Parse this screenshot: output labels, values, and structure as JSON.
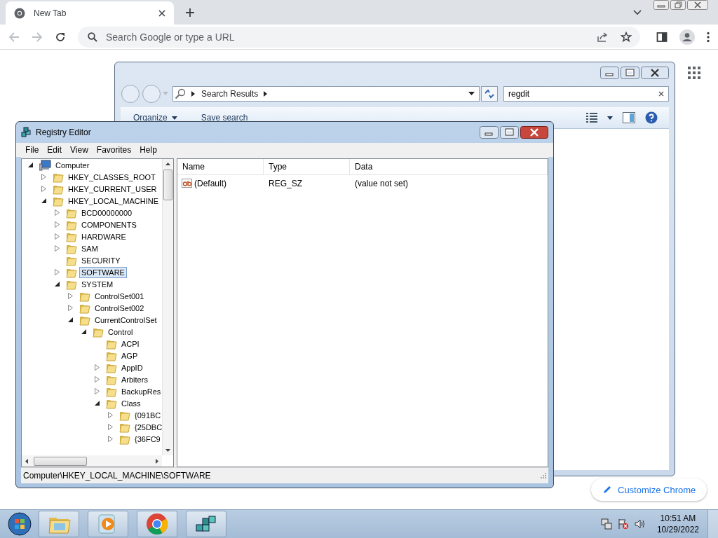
{
  "browser": {
    "tab": {
      "title": "New Tab"
    },
    "omnibox": {
      "placeholder": "Search Google or type a URL"
    },
    "customize_button": "Customize Chrome"
  },
  "explorer": {
    "address": {
      "crumb": "Search Results"
    },
    "search": {
      "value": "regdit"
    },
    "toolbar": [
      {
        "label": "Organize",
        "dropdown": true
      },
      {
        "label": "Save search",
        "dropdown": false
      }
    ]
  },
  "regedit": {
    "title": "Registry Editor",
    "menu": [
      "File",
      "Edit",
      "View",
      "Favorites",
      "Help"
    ],
    "tree": [
      {
        "label": "Computer",
        "kind": "computer",
        "expandable": true,
        "expanded": true,
        "selected": false,
        "children": [
          {
            "label": "HKEY_CLASSES_ROOT",
            "kind": "folder",
            "expandable": true,
            "expanded": false,
            "selected": false
          },
          {
            "label": "HKEY_CURRENT_USER",
            "kind": "folder",
            "expandable": true,
            "expanded": false,
            "selected": false
          },
          {
            "label": "HKEY_LOCAL_MACHINE",
            "kind": "folder",
            "expandable": true,
            "expanded": true,
            "selected": false,
            "children": [
              {
                "label": "BCD00000000",
                "kind": "folder",
                "expandable": true,
                "expanded": false,
                "selected": false
              },
              {
                "label": "COMPONENTS",
                "kind": "folder",
                "expandable": true,
                "expanded": false,
                "selected": false
              },
              {
                "label": "HARDWARE",
                "kind": "folder",
                "expandable": true,
                "expanded": false,
                "selected": false
              },
              {
                "label": "SAM",
                "kind": "folder",
                "expandable": true,
                "expanded": false,
                "selected": false
              },
              {
                "label": "SECURITY",
                "kind": "folder",
                "expandable": false,
                "selected": false
              },
              {
                "label": "SOFTWARE",
                "kind": "folder",
                "expandable": true,
                "expanded": false,
                "selected": true
              },
              {
                "label": "SYSTEM",
                "kind": "folder",
                "expandable": true,
                "expanded": true,
                "selected": false,
                "children": [
                  {
                    "label": "ControlSet001",
                    "kind": "folder",
                    "expandable": true,
                    "expanded": false,
                    "selected": false
                  },
                  {
                    "label": "ControlSet002",
                    "kind": "folder",
                    "expandable": true,
                    "expanded": false,
                    "selected": false
                  },
                  {
                    "label": "CurrentControlSet",
                    "kind": "folder",
                    "expandable": true,
                    "expanded": true,
                    "selected": false,
                    "children": [
                      {
                        "label": "Control",
                        "kind": "folder",
                        "expandable": true,
                        "expanded": true,
                        "selected": false,
                        "children": [
                          {
                            "label": "ACPI",
                            "kind": "folder",
                            "expandable": false,
                            "selected": false
                          },
                          {
                            "label": "AGP",
                            "kind": "folder",
                            "expandable": false,
                            "selected": false
                          },
                          {
                            "label": "AppID",
                            "kind": "folder",
                            "expandable": true,
                            "expanded": false,
                            "selected": false
                          },
                          {
                            "label": "Arbiters",
                            "kind": "folder",
                            "expandable": true,
                            "expanded": false,
                            "selected": false
                          },
                          {
                            "label": "BackupRes",
                            "kind": "folder",
                            "expandable": true,
                            "expanded": false,
                            "selected": false
                          },
                          {
                            "label": "Class",
                            "kind": "folder",
                            "expandable": true,
                            "expanded": true,
                            "selected": false,
                            "children": [
                              {
                                "label": "{091BC",
                                "kind": "folder",
                                "expandable": true,
                                "expanded": false,
                                "selected": false
                              },
                              {
                                "label": "{25DBC",
                                "kind": "folder",
                                "expandable": true,
                                "expanded": false,
                                "selected": false
                              },
                              {
                                "label": "{36FC9",
                                "kind": "folder",
                                "expandable": true,
                                "expanded": false,
                                "selected": false
                              }
                            ]
                          }
                        ]
                      }
                    ]
                  }
                ]
              }
            ]
          }
        ]
      }
    ],
    "columns": [
      "Name",
      "Type",
      "Data"
    ],
    "rows": [
      {
        "name": "(Default)",
        "type": "REG_SZ",
        "data": "(value not set)"
      }
    ],
    "status_bar": "Computer\\HKEY_LOCAL_MACHINE\\SOFTWARE"
  },
  "taskbar": {
    "apps": [
      {
        "kind": "explorer"
      },
      {
        "kind": "media"
      },
      {
        "kind": "chrome"
      },
      {
        "kind": "regedit"
      }
    ],
    "clock": {
      "time": "10:51 AM",
      "date": "10/29/2022"
    }
  }
}
